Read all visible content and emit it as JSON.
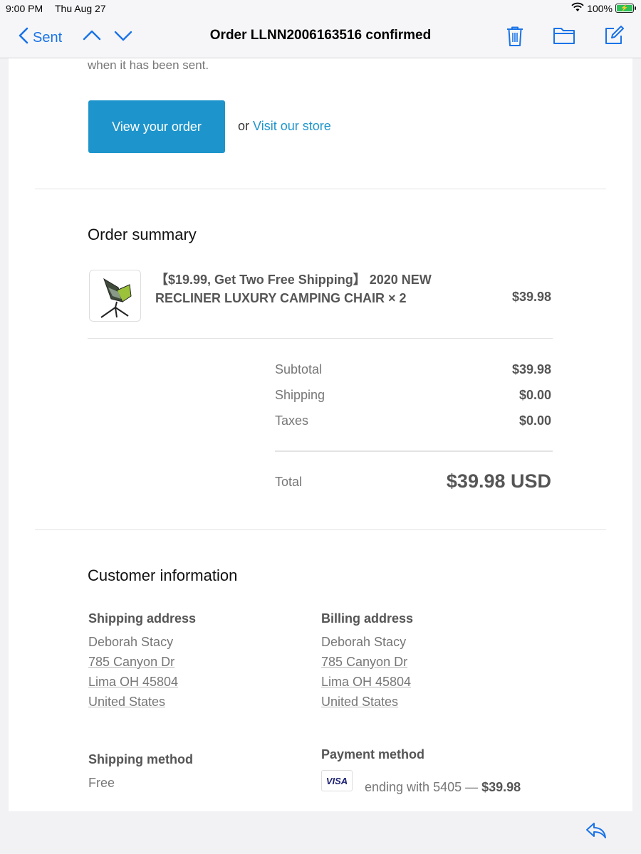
{
  "status_bar": {
    "time": "9:00 PM",
    "date": "Thu Aug 27",
    "battery": "100%"
  },
  "nav": {
    "back_label": "Sent",
    "title": "Order LLNN2006163516 confirmed",
    "accent_color": "#1a73e8"
  },
  "email": {
    "intro_text": "when it has been sent.",
    "cta_label": "View your order",
    "or_text": "or",
    "store_link": "Visit our store",
    "order_summary": {
      "title": "Order summary",
      "item": {
        "name": "【$19.99, Get Two Free Shipping】 2020 NEW RECLINER LUXURY CAMPING CHAIR × 2",
        "price": "$39.98"
      },
      "subtotal_label": "Subtotal",
      "subtotal_value": "$39.98",
      "shipping_label": "Shipping",
      "shipping_value": "$0.00",
      "taxes_label": "Taxes",
      "taxes_value": "$0.00",
      "total_label": "Total",
      "total_value": "$39.98 USD"
    },
    "customer": {
      "title": "Customer information",
      "shipping_address": {
        "heading": "Shipping address",
        "name": "Deborah Stacy",
        "street": "785 Canyon Dr",
        "city": "Lima OH 45804",
        "country": "United States"
      },
      "billing_address": {
        "heading": "Billing address",
        "name": "Deborah Stacy",
        "street": "785 Canyon Dr",
        "city": "Lima OH 45804",
        "country": "United States"
      },
      "shipping_method": {
        "heading": "Shipping method",
        "value": "Free"
      },
      "payment_method": {
        "heading": "Payment method",
        "card_brand": "VISA",
        "ending_text": "ending with 5405 —",
        "amount": "$39.98"
      }
    },
    "button_color": "#1d95cc"
  }
}
